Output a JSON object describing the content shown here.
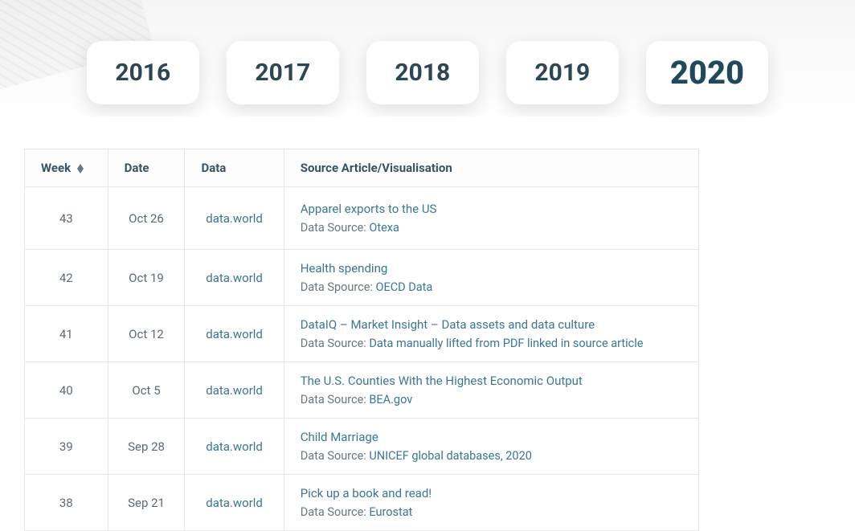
{
  "tabs": {
    "years": [
      "2016",
      "2017",
      "2018",
      "2019",
      "2020"
    ],
    "activeIndex": 4
  },
  "table": {
    "headers": {
      "week": "Week",
      "date": "Date",
      "data": "Data",
      "source": "Source Article/Visualisation"
    },
    "rows": [
      {
        "week": "43",
        "date": "Oct 26",
        "data": "data.world",
        "title": "Apparel exports to the US",
        "meta_label": "Data Source: ",
        "meta_value": "Otexa",
        "spacious": true
      },
      {
        "week": "42",
        "date": "Oct 19",
        "data": "data.world",
        "title": "Health spending",
        "meta_label": "Data Spource: ",
        "meta_value": "OECD Data"
      },
      {
        "week": "41",
        "date": "Oct 12",
        "data": "data.world",
        "title": "DataIQ – Market Insight – Data assets and data culture",
        "meta_label": "Data Source: ",
        "meta_value": "Data manually lifted from PDF linked in source article"
      },
      {
        "week": "40",
        "date": "Oct 5",
        "data": "data.world",
        "title": "The U.S. Counties With the Highest Economic Output",
        "meta_label": "Data Source: ",
        "meta_value": "BEA.gov"
      },
      {
        "week": "39",
        "date": "Sep 28",
        "data": "data.world",
        "title": "Child Marriage",
        "meta_label": "Data Source: ",
        "meta_value": "UNICEF global databases, 2020"
      },
      {
        "week": "38",
        "date": "Sep 21",
        "data": "data.world",
        "title": "Pick up a book and read!",
        "meta_label": "Data Source: ",
        "meta_value": "Eurostat"
      }
    ]
  }
}
